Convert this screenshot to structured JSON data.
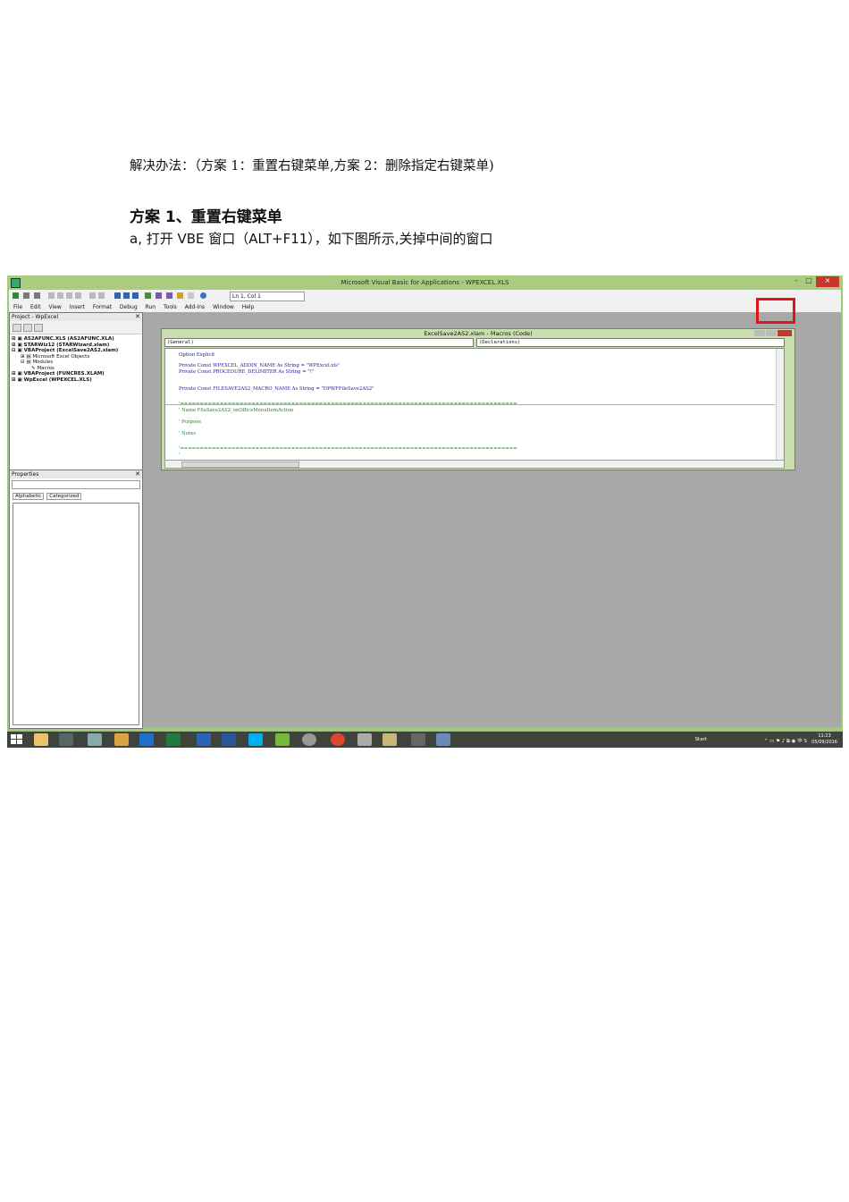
{
  "document": {
    "line1": "解决办法：（方案 1：重置右键菜单,方案 2：删除指定右键菜单)",
    "line2": "方案 1、重置右键菜单",
    "line3": "a, 打开 VBE 窗口（ALT+F11），如下图所示,关掉中间的窗口"
  },
  "screenshot": {
    "window_title": "Microsoft Visual Basic for Applications - WPEXCEL.XLS",
    "position_indicator": "Ln 1, Col 1",
    "menu": [
      "File",
      "Edit",
      "View",
      "Insert",
      "Format",
      "Debug",
      "Run",
      "Tools",
      "Add-Ins",
      "Window",
      "Help"
    ],
    "project_panel": {
      "title": "Project - WpExcel",
      "items": [
        "AS2AFUNC.XLS (AS2AFUNC.XLA)",
        "STARWiz12 (STARWizard.xlam)",
        "VBAProject (ExcelSave2AS2.xlam)",
        "Microsoft Excel Objects",
        "Modules",
        "Macros",
        "VBAProject (FUNCRES.XLAM)",
        "WpExcel (WPEXCEL.XLS)"
      ]
    },
    "properties_panel": {
      "title": "Properties",
      "tabs": [
        "Alphabetic",
        "Categorized"
      ]
    },
    "code_window": {
      "title": "ExcelSave2AS2.xlam - Macros (Code)",
      "object_box": "(General)",
      "proc_box": "(Declarations)",
      "lines": [
        "Option Explicit",
        "Private Const WPEXCEL_ADDIN_NAME As String = \"WPExcel.xls\"",
        "Private Const PROCEDURE_DELIMITER   As String = \"!\"",
        "Private Const FILESAVE2AS2_MACRO_NAME As String = \"DPWFFileSave2AS2\"",
        "'=====================================================================================",
        "' Name      FileSave2AS2_onOfficeMenuItemAction",
        "' Purpose",
        "' Notes",
        "'=====================================================================================",
        "'"
      ]
    },
    "ime_label": "中",
    "taskbar": {
      "start_label": "Start",
      "time": "11:23",
      "date": "05/09/2016",
      "tray_lang": "中"
    },
    "colors": {
      "title_bar": "#a8cc80",
      "highlight_box": "#e01515",
      "code_keyword": "#1c1c99",
      "code_comment": "#1d8a26",
      "taskbar": "#3e443c"
    }
  }
}
